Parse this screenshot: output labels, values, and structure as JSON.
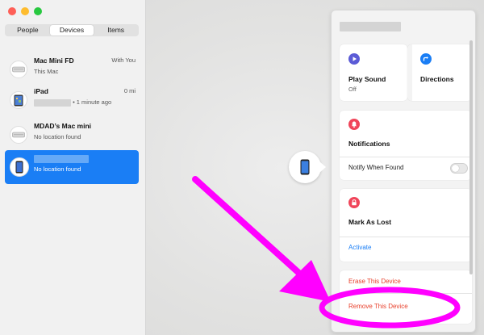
{
  "window": {
    "traffic_colors": [
      "#fe5f57",
      "#febc2e",
      "#28c840"
    ]
  },
  "tabs": [
    {
      "label": "People",
      "active": false
    },
    {
      "label": "Devices",
      "active": true
    },
    {
      "label": "Items",
      "active": false
    }
  ],
  "devices": [
    {
      "name": "Mac Mini FD",
      "sub": "This Mac",
      "distance": "With You",
      "icon": "mac-mini-icon"
    },
    {
      "name": "iPad",
      "sub": "• 1 minute ago",
      "distance": "0 mi",
      "icon": "ipad-icon"
    },
    {
      "name": "MDAD’s Mac mini",
      "sub": "No location found",
      "distance": "",
      "icon": "mac-mini-icon"
    },
    {
      "name": "",
      "sub": "No location found",
      "distance": "",
      "icon": "iphone-icon",
      "selected": true
    }
  ],
  "panel": {
    "play_sound": {
      "title": "Play Sound",
      "sub": "Off",
      "color": "#5b5bd6"
    },
    "directions": {
      "title": "Directions",
      "color": "#1a7ef5"
    },
    "notifications": {
      "title": "Notifications",
      "toggle_label": "Notify When Found",
      "color": "#f0455a"
    },
    "mark_as_lost": {
      "title": "Mark As Lost",
      "action": "Activate",
      "color": "#f0455a"
    },
    "erase_label": "Erase This Device",
    "remove_label": "Remove This Device"
  },
  "colors": {
    "accent": "#1a7ef5",
    "destructive": "#e8402c",
    "annotation": "#ff00ff"
  }
}
